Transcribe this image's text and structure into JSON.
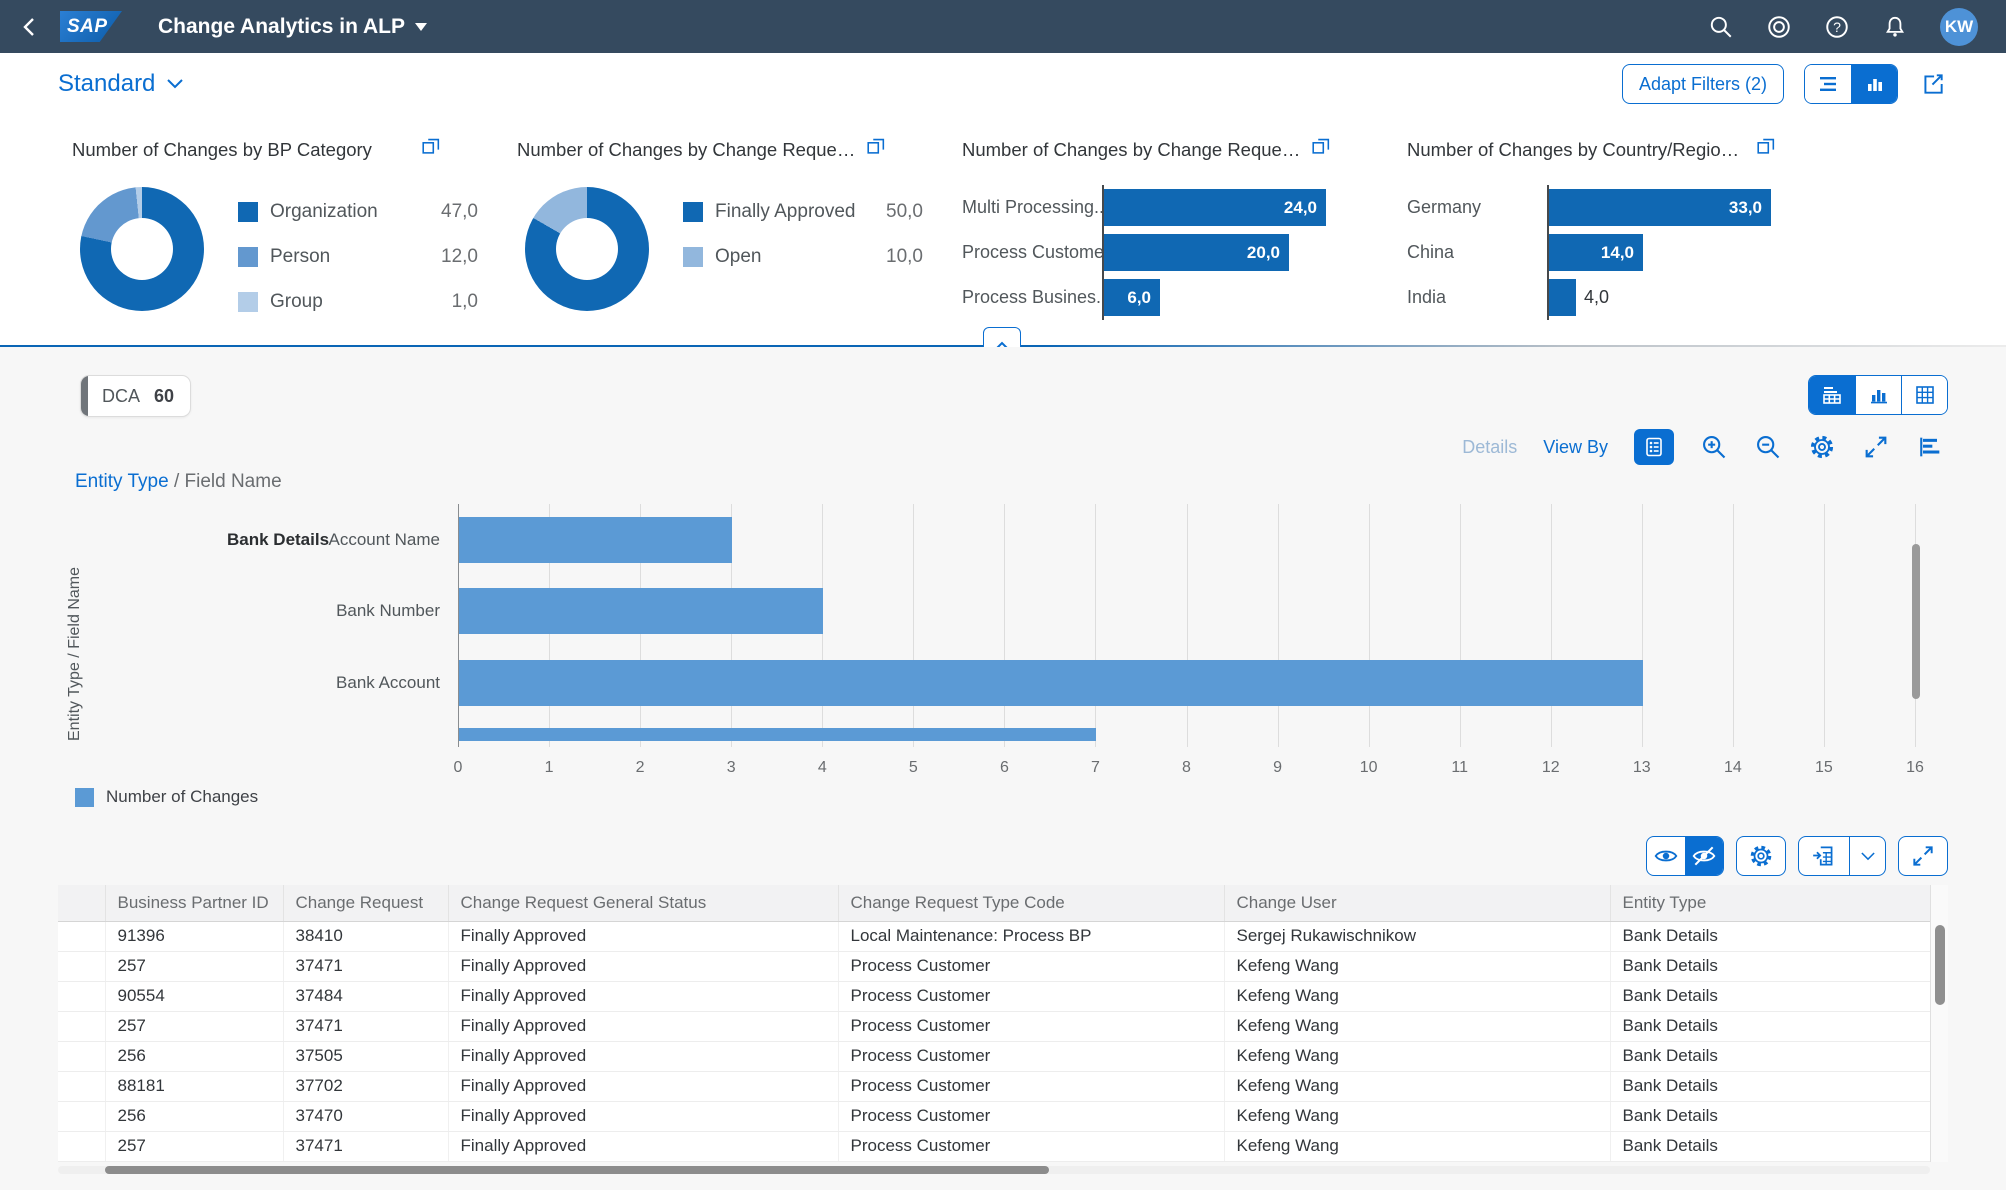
{
  "shell": {
    "logo_text": "SAP",
    "title": "Change Analytics in ALP",
    "avatar": "KW",
    "icons": [
      "back-icon",
      "search-icon",
      "copilot-icon",
      "help-icon",
      "bell-icon"
    ]
  },
  "filterbar": {
    "variant_label": "Standard",
    "adapt_filters_label": "Adapt Filters (2)",
    "icons": [
      "filter-rows-icon",
      "bar-chart-icon",
      "share-icon"
    ]
  },
  "accent_color": "#0a6ed1",
  "content": {
    "chip_label": "DCA",
    "chip_count": "60",
    "view_switch_icons": [
      "chart-table-view-icon",
      "chart-view-icon",
      "table-view-icon"
    ]
  },
  "chart": {
    "toolbar": {
      "details_label": "Details",
      "view_by_label": "View By",
      "icons": [
        "legend-icon",
        "zoom-in-icon",
        "zoom-out-icon",
        "settings-icon",
        "fullscreen-icon",
        "horizontal-bar-chart-icon"
      ]
    },
    "breadcrumb_link": "Entity Type",
    "breadcrumb_sep": "/",
    "breadcrumb_current": "Field Name"
  },
  "chart_data": [
    {
      "type": "pie",
      "donut": true,
      "title": "Number of Changes by BP Category",
      "labels": [
        "Organization",
        "Person",
        "Group"
      ],
      "values": [
        47,
        12,
        1
      ],
      "display_values": [
        "47,0",
        "12,0",
        "1,0"
      ],
      "colors": [
        "#1068b3",
        "#6398cf",
        "#b3cde8"
      ],
      "legend_position": "right"
    },
    {
      "type": "pie",
      "donut": true,
      "title": "Number of Changes by Change Request ...",
      "labels": [
        "Finally Approved",
        "Open"
      ],
      "values": [
        50,
        10
      ],
      "display_values": [
        "50,0",
        "10,0"
      ],
      "colors": [
        "#1068b3",
        "#92b7dd"
      ],
      "legend_position": "right"
    },
    {
      "type": "bar",
      "orientation": "horizontal",
      "title": "Number of Changes by Change Request T...",
      "categories": [
        "Multi Processing...",
        "Process Customer",
        "Process Busines..."
      ],
      "values": [
        24,
        20,
        6
      ],
      "display_values": [
        "24,0",
        "20,0",
        "6,0"
      ],
      "bar_color": "#1068b3",
      "xlim": [
        0,
        24
      ]
    },
    {
      "type": "bar",
      "orientation": "horizontal",
      "title": "Number of Changes by Country/Region Key",
      "categories": [
        "Germany",
        "China",
        "India"
      ],
      "values": [
        33,
        14,
        4
      ],
      "display_values": [
        "33,0",
        "14,0",
        "4,0"
      ],
      "bar_color": "#1068b3",
      "xlim": [
        0,
        33
      ]
    },
    {
      "type": "bar",
      "orientation": "horizontal",
      "title": "",
      "group_label": "Bank Details",
      "categories": [
        "Account Name",
        "Bank Number",
        "Bank Account",
        ""
      ],
      "values": [
        3,
        4,
        13,
        7
      ],
      "bar_color": "#5b9ad5",
      "xlabel": "",
      "ylabel": "Entity Type / Field Name",
      "xlim": [
        0,
        16
      ],
      "xticks": [
        0,
        1,
        2,
        3,
        4,
        5,
        6,
        7,
        8,
        9,
        10,
        11,
        12,
        13,
        14,
        15,
        16
      ],
      "grid": true,
      "legend_position": "bottom-left",
      "series_name": "Number of Changes",
      "note": "fourth bar partially scrolled out of view at bottom"
    }
  ],
  "table": {
    "toolbar_icons": [
      "eye-icon",
      "eye-slash-icon",
      "settings-icon",
      "export-spreadsheet-icon",
      "chevron-down-icon",
      "fullscreen-icon"
    ],
    "columns": [
      "Business Partner ID",
      "Change Request",
      "Change Request General Status",
      "Change Request Type Code",
      "Change User",
      "Entity Type"
    ],
    "rows": [
      [
        "91396",
        "38410",
        "Finally Approved",
        "Local Maintenance: Process BP",
        "Sergej Rukawischnikow",
        "Bank Details"
      ],
      [
        "257",
        "37471",
        "Finally Approved",
        "Process Customer",
        "Kefeng Wang",
        "Bank Details"
      ],
      [
        "90554",
        "37484",
        "Finally Approved",
        "Process Customer",
        "Kefeng Wang",
        "Bank Details"
      ],
      [
        "257",
        "37471",
        "Finally Approved",
        "Process Customer",
        "Kefeng Wang",
        "Bank Details"
      ],
      [
        "256",
        "37505",
        "Finally Approved",
        "Process Customer",
        "Kefeng Wang",
        "Bank Details"
      ],
      [
        "88181",
        "37702",
        "Finally Approved",
        "Process Customer",
        "Kefeng Wang",
        "Bank Details"
      ],
      [
        "256",
        "37470",
        "Finally Approved",
        "Process Customer",
        "Kefeng Wang",
        "Bank Details"
      ],
      [
        "257",
        "37471",
        "Finally Approved",
        "Process Customer",
        "Kefeng Wang",
        "Bank Details"
      ]
    ]
  }
}
